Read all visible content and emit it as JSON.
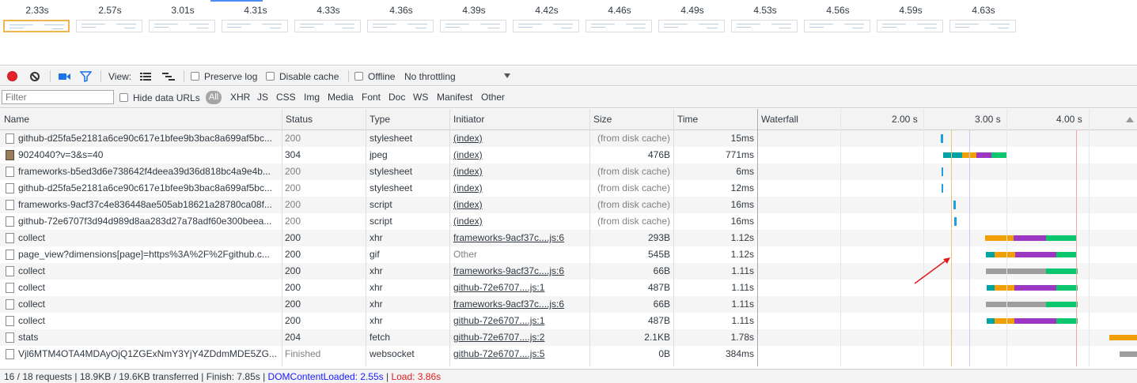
{
  "filmstrip": {
    "times": [
      "2.33s",
      "2.57s",
      "3.01s",
      "4.31s",
      "4.33s",
      "4.36s",
      "4.39s",
      "4.42s",
      "4.46s",
      "4.49s",
      "4.53s",
      "4.56s",
      "4.59s",
      "4.63s"
    ]
  },
  "toolbar": {
    "view_label": "View:",
    "preserve_log": "Preserve log",
    "disable_cache": "Disable cache",
    "offline": "Offline",
    "throttling": "No throttling"
  },
  "filterbar": {
    "placeholder": "Filter",
    "hide_data_urls": "Hide data URLs",
    "all": "All",
    "types": [
      "XHR",
      "JS",
      "CSS",
      "Img",
      "Media",
      "Font",
      "Doc",
      "WS",
      "Manifest",
      "Other"
    ]
  },
  "table": {
    "headers": {
      "name": "Name",
      "status": "Status",
      "type": "Type",
      "initiator": "Initiator",
      "size": "Size",
      "time": "Time",
      "waterfall": "Waterfall"
    },
    "waterfall_ticks": [
      "2.00 s",
      "3.00 s",
      "4.00 s"
    ],
    "rows": [
      {
        "name": "github-d25fa5e2181a6ce90c617e1bfee9b3bac8a699af5bc...",
        "status": "200",
        "type": "stylesheet",
        "initiator": "(index)",
        "size": "(from disk cache)",
        "time": "15ms",
        "icon": "document-icon"
      },
      {
        "name": "9024040?v=3&s=40",
        "status": "304",
        "type": "jpeg",
        "initiator": "(index)",
        "size": "476B",
        "time": "771ms",
        "icon": "image-icon"
      },
      {
        "name": "frameworks-b5ed3d6e738642f4deea39d36d818bc4a9e4b...",
        "status": "200",
        "type": "stylesheet",
        "initiator": "(index)",
        "size": "(from disk cache)",
        "time": "6ms",
        "icon": "document-icon"
      },
      {
        "name": "github-d25fa5e2181a6ce90c617e1bfee9b3bac8a699af5bc...",
        "status": "200",
        "type": "stylesheet",
        "initiator": "(index)",
        "size": "(from disk cache)",
        "time": "12ms",
        "icon": "document-icon"
      },
      {
        "name": "frameworks-9acf37c4e836448ae505ab18621a28780ca08f...",
        "status": "200",
        "type": "script",
        "initiator": "(index)",
        "size": "(from disk cache)",
        "time": "16ms",
        "icon": "document-icon"
      },
      {
        "name": "github-72e6707f3d94d989d8aa283d27a78adf60e300beea...",
        "status": "200",
        "type": "script",
        "initiator": "(index)",
        "size": "(from disk cache)",
        "time": "16ms",
        "icon": "document-icon"
      },
      {
        "name": "collect",
        "status": "200",
        "type": "xhr",
        "initiator": "frameworks-9acf37c....js:6",
        "size": "293B",
        "time": "1.12s",
        "icon": "document-icon"
      },
      {
        "name": "page_view?dimensions[page]=https%3A%2F%2Fgithub.c...",
        "status": "200",
        "type": "gif",
        "initiator": "Other",
        "size": "545B",
        "time": "1.12s",
        "icon": "document-icon"
      },
      {
        "name": "collect",
        "status": "200",
        "type": "xhr",
        "initiator": "frameworks-9acf37c....js:6",
        "size": "66B",
        "time": "1.11s",
        "icon": "document-icon"
      },
      {
        "name": "collect",
        "status": "200",
        "type": "xhr",
        "initiator": "github-72e6707....js:1",
        "size": "487B",
        "time": "1.11s",
        "icon": "document-icon"
      },
      {
        "name": "collect",
        "status": "200",
        "type": "xhr",
        "initiator": "frameworks-9acf37c....js:6",
        "size": "66B",
        "time": "1.11s",
        "icon": "document-icon"
      },
      {
        "name": "collect",
        "status": "200",
        "type": "xhr",
        "initiator": "github-72e6707....js:1",
        "size": "487B",
        "time": "1.11s",
        "icon": "document-icon"
      },
      {
        "name": "stats",
        "status": "204",
        "type": "fetch",
        "initiator": "github-72e6707....js:2",
        "size": "2.1KB",
        "time": "1.78s",
        "icon": "document-icon"
      },
      {
        "name": "Vjl6MTM4OTA4MDAyOjQ1ZGExNmY3YjY4ZDdmMDE5ZG...",
        "status": "Finished",
        "type": "websocket",
        "initiator": "github-72e6707....js:5",
        "size": "0B",
        "time": "384ms",
        "icon": "document-icon"
      }
    ]
  },
  "statusbar": {
    "summary": "16 / 18 requests | 18.9KB / 19.6KB transferred | Finish: 7.85s | ",
    "dom_content_loaded": "DOMContentLoaded: 2.55s",
    "separator": " | ",
    "load": "Load: 3.86s"
  },
  "colors": {
    "dcl": "#0000ff",
    "load": "#ff0000",
    "queue": "#00a3a3",
    "wait": "#f29f05",
    "ttfb": "#9b37c2",
    "download": "#0bc66d",
    "stalled": "#9e9e9e",
    "cached": "#1ba1e2"
  }
}
